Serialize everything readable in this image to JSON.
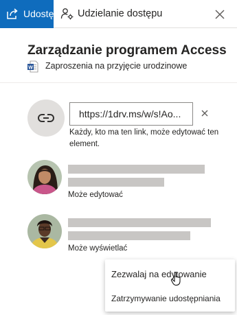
{
  "header": {
    "share_tab_label": "Udostępnij",
    "access_tab_label": "Udzielanie dostępu",
    "close_icon": "close-icon",
    "accent_color": "#0f6cbd"
  },
  "title": "Zarządzanie programem Access",
  "document": {
    "icon": "word-document-icon",
    "name": "Zaproszenia na przyjęcie urodzinowe"
  },
  "link": {
    "icon": "link-icon",
    "url": "https://1drv.ms/w/s!Ao...",
    "remove_icon": "close-icon",
    "description": "Każdy, kto ma ten link, może edytować ten element."
  },
  "people": [
    {
      "icon": "avatar-woman",
      "permission": "Może edytować"
    },
    {
      "icon": "avatar-man",
      "permission": "Może wyświetlać"
    }
  ],
  "menu": {
    "items": [
      {
        "label": "Zezwalaj na edytowanie"
      },
      {
        "label": "Zatrzymywanie udostępniania"
      }
    ]
  }
}
